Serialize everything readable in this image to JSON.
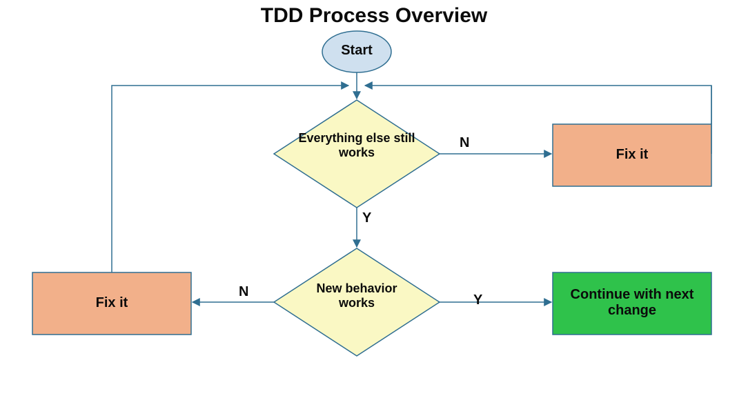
{
  "title": "TDD Process Overview",
  "nodes": {
    "start": {
      "label": "Start"
    },
    "decision1": {
      "label": "Everything else still works"
    },
    "decision2": {
      "label": "New behavior works"
    },
    "fix_left": {
      "label": "Fix it"
    },
    "fix_right": {
      "label": "Fix it"
    },
    "continue": {
      "label": "Continue with next change"
    }
  },
  "edges": {
    "d1_no": "N",
    "d1_yes": "Y",
    "d2_no": "N",
    "d2_yes": "Y"
  },
  "chart_data": {
    "type": "flowchart",
    "title": "TDD Process Overview",
    "nodes": [
      {
        "id": "start",
        "shape": "ellipse",
        "label": "Start",
        "fill": "#cfe0ef"
      },
      {
        "id": "d1",
        "shape": "diamond",
        "label": "Everything else still works",
        "fill": "#faf8c4"
      },
      {
        "id": "d2",
        "shape": "diamond",
        "label": "New behavior works",
        "fill": "#faf8c4"
      },
      {
        "id": "fixL",
        "shape": "rect",
        "label": "Fix it",
        "fill": "#f2b08a"
      },
      {
        "id": "fixR",
        "shape": "rect",
        "label": "Fix it",
        "fill": "#f2b08a"
      },
      {
        "id": "cont",
        "shape": "rect",
        "label": "Continue with next change",
        "fill": "#2fc24b"
      }
    ],
    "edges": [
      {
        "from": "start",
        "to": "d1",
        "label": ""
      },
      {
        "from": "d1",
        "to": "fixR",
        "label": "N"
      },
      {
        "from": "fixR",
        "to": "d1",
        "label": "",
        "note": "loop back to top"
      },
      {
        "from": "d1",
        "to": "d2",
        "label": "Y"
      },
      {
        "from": "d2",
        "to": "fixL",
        "label": "N"
      },
      {
        "from": "fixL",
        "to": "d1",
        "label": "",
        "note": "loop back to top"
      },
      {
        "from": "d2",
        "to": "cont",
        "label": "Y"
      }
    ]
  }
}
